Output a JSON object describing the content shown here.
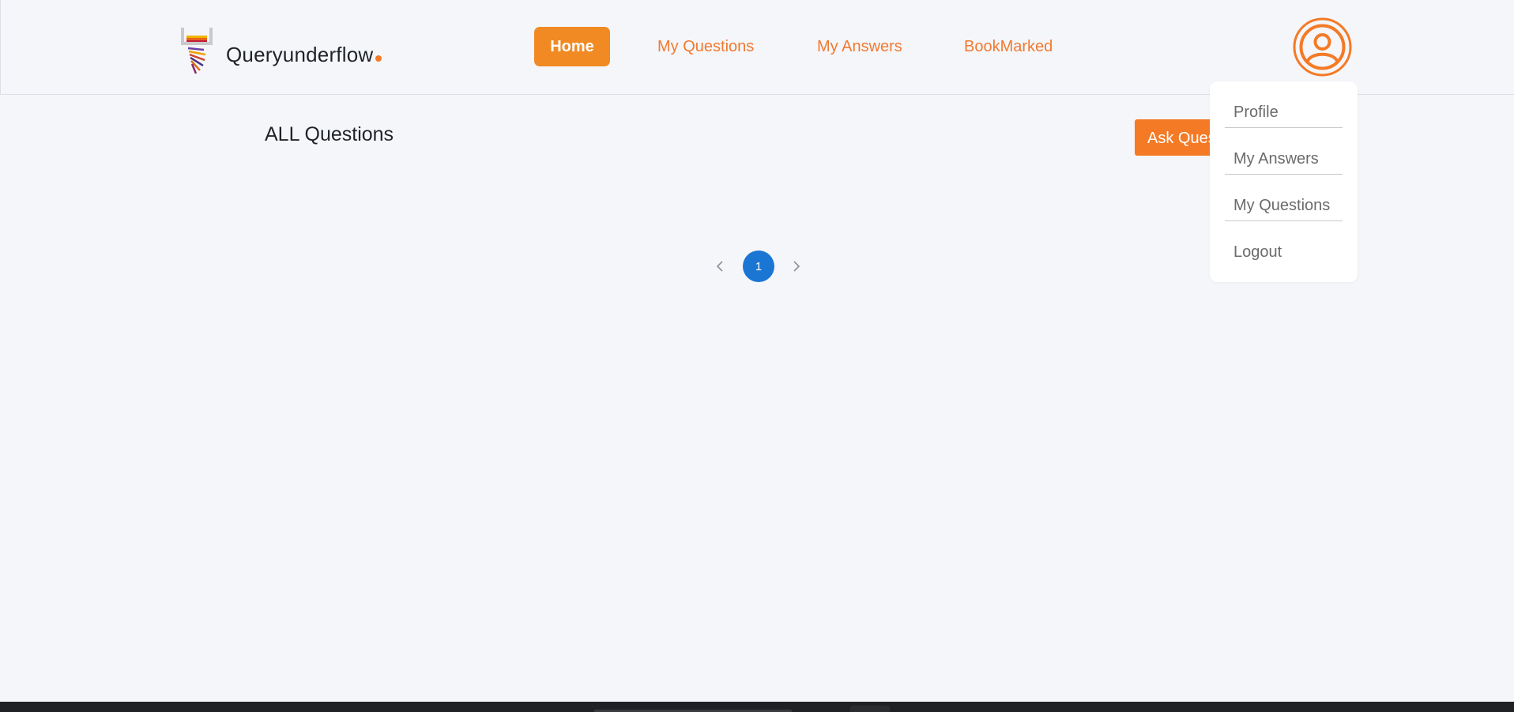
{
  "header": {
    "brand": "Queryunderflow",
    "nav": {
      "home": "Home",
      "my_questions": "My Questions",
      "my_answers": "My Answers",
      "bookmarked": "BookMarked"
    },
    "avatar_icon": "user-circle-icon",
    "logo_icon": "stack-logo-icon"
  },
  "main": {
    "title": "ALL Questions",
    "ask_button": "Ask Question"
  },
  "pagination": {
    "prev_icon": "chevron-left-icon",
    "next_icon": "chevron-right-icon",
    "current_page": "1"
  },
  "user_menu": {
    "items": [
      "Profile",
      "My Answers",
      "My Questions",
      "Logout"
    ]
  },
  "colors": {
    "accent_orange": "#f47a26",
    "home_button": "#f18a22",
    "page_active": "#1a76d2",
    "background": "#f5f6fa"
  }
}
